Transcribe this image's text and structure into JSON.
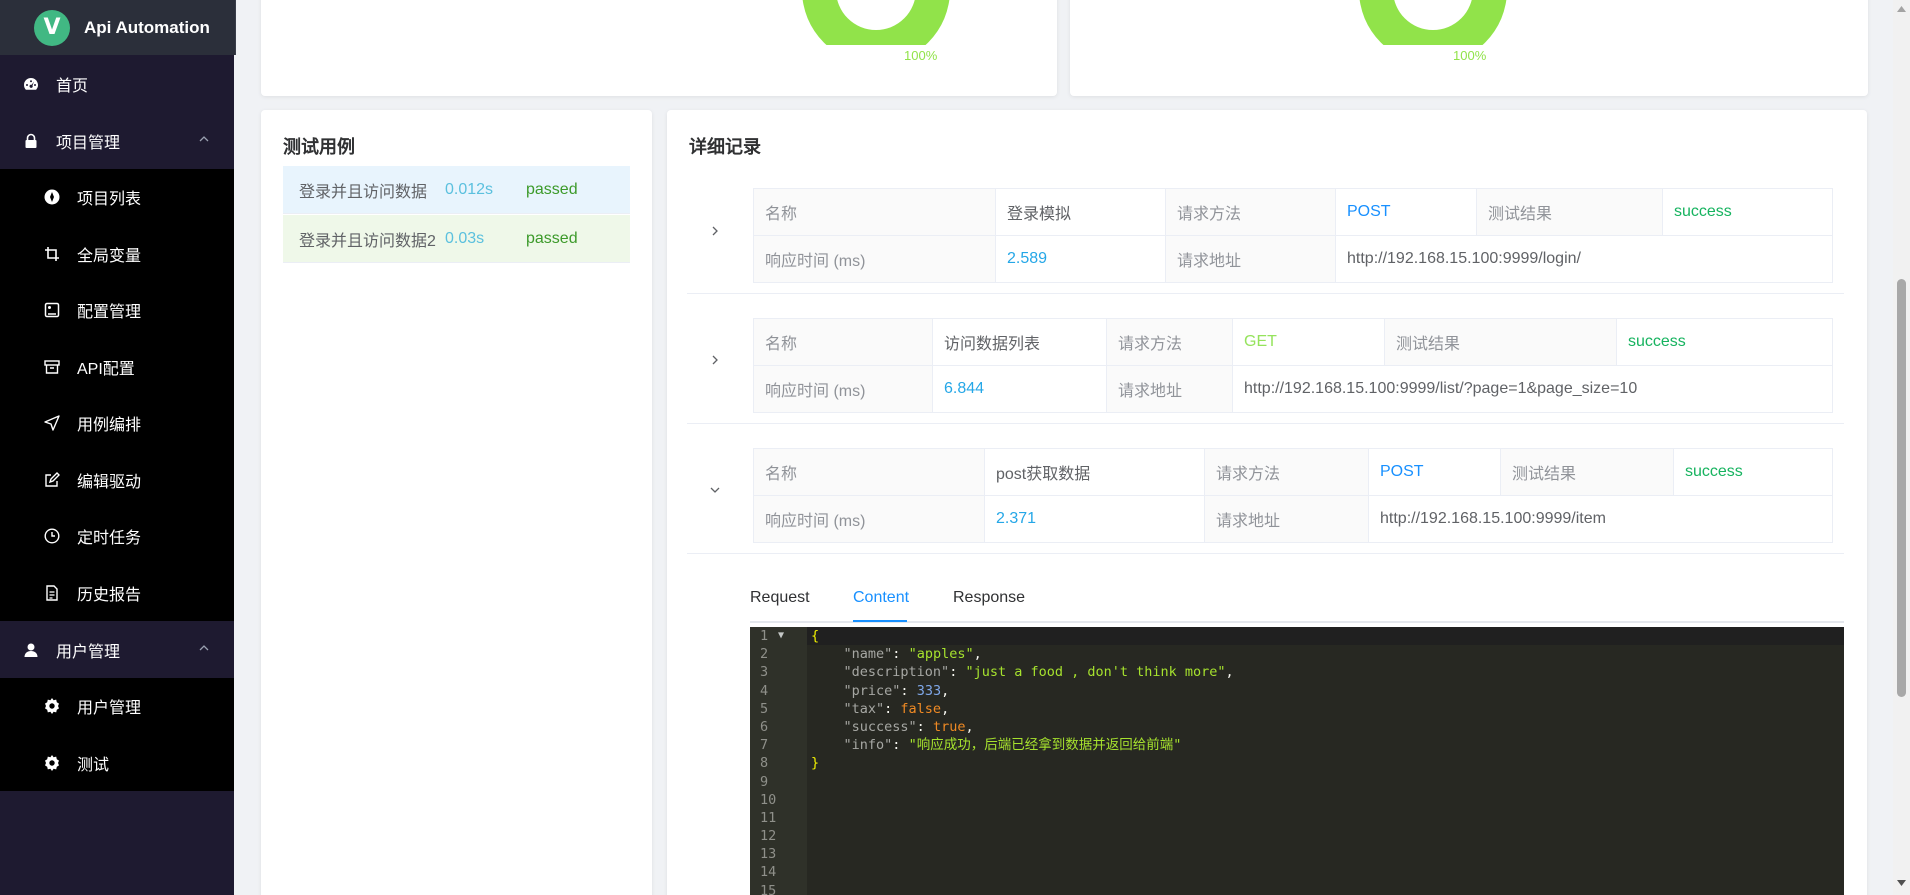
{
  "app": {
    "title": "Api Automation",
    "logo_letter": "V"
  },
  "sidebar": {
    "home": "首页",
    "project_group": "项目管理",
    "project_items": [
      "项目列表",
      "全局变量",
      "配置管理",
      "API配置",
      "用例编排",
      "编辑驱动",
      "定时任务",
      "历史报告"
    ],
    "user_group": "用户管理",
    "user_items": [
      "用户管理",
      "测试"
    ]
  },
  "summary": {
    "left_pct": "100%",
    "right_pct": "100%",
    "accent": "#91e34a"
  },
  "cases": {
    "title": "测试用例",
    "rows": [
      {
        "name": "登录并且访问数据",
        "time": "0.012s",
        "status": "passed"
      },
      {
        "name": "登录并且访问数据2",
        "time": "0.03s",
        "status": "passed"
      }
    ]
  },
  "detail": {
    "title": "详细记录",
    "labels": {
      "name": "名称",
      "method": "请求方法",
      "result": "测试结果",
      "resp_time": "响应时间 (ms)",
      "url": "请求地址"
    },
    "records": [
      {
        "name": "登录模拟",
        "method": "POST",
        "result": "success",
        "resp_time": "2.589",
        "url": "http://192.168.15.100:9999/login/"
      },
      {
        "name": "访问数据列表",
        "method": "GET",
        "result": "success",
        "resp_time": "6.844",
        "url": "http://192.168.15.100:9999/list/?page=1&page_size=10"
      },
      {
        "name": "post获取数据",
        "method": "POST",
        "result": "success",
        "resp_time": "2.371",
        "url": "http://192.168.15.100:9999/item"
      }
    ],
    "tabs": [
      "Request",
      "Content",
      "Response"
    ],
    "active_tab": "Content",
    "editor": {
      "line_numbers": [
        "1",
        "2",
        "3",
        "4",
        "5",
        "6",
        "7",
        "8",
        "9",
        "10",
        "11",
        "12",
        "13",
        "14",
        "15"
      ],
      "json": {
        "k_name": "\"name\"",
        "v_name": "\"apples\"",
        "k_desc": "\"description\"",
        "v_desc": "\"just a food , don't think more\"",
        "k_price": "\"price\"",
        "v_price": "333",
        "k_tax": "\"tax\"",
        "v_tax": "false",
        "k_success": "\"success\"",
        "v_success": "true",
        "k_info": "\"info\"",
        "v_info": "\"响应成功，后端已经拿到数据并返回给前端\""
      }
    }
  }
}
